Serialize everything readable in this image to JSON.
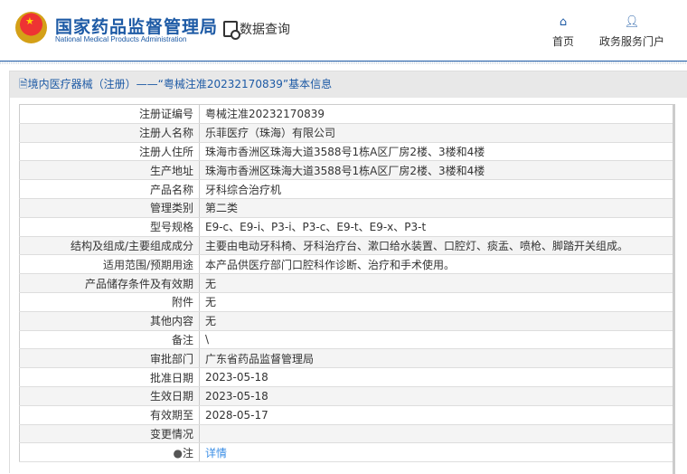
{
  "header": {
    "org_cn": "国家药品监督管理局",
    "org_en": "National Medical Products Administration",
    "data_query": "数据查询",
    "nav": [
      {
        "label": "首页",
        "icon": "home-icon"
      },
      {
        "label": "政务服务门户",
        "icon": "user-icon"
      }
    ]
  },
  "breadcrumb": "境内医疗器械（注册）——“粤械注准20232170839”基本信息",
  "rows": [
    {
      "label": "注册证编号",
      "value": "粤械注准20232170839"
    },
    {
      "label": "注册人名称",
      "value": "乐菲医疗（珠海）有限公司"
    },
    {
      "label": "注册人住所",
      "value": "珠海市香洲区珠海大道3588号1栋A区厂房2楼、3楼和4楼"
    },
    {
      "label": "生产地址",
      "value": "珠海市香洲区珠海大道3588号1栋A区厂房2楼、3楼和4楼"
    },
    {
      "label": "产品名称",
      "value": "牙科综合治疗机"
    },
    {
      "label": "管理类别",
      "value": "第二类"
    },
    {
      "label": "型号规格",
      "value": "E9-c、E9-i、P3-i、P3-c、E9-t、E9-x、P3-t"
    },
    {
      "label": "结构及组成/主要组成成分",
      "value": "主要由电动牙科椅、牙科治疗台、漱口给水装置、口腔灯、痰盂、喷枪、脚踏开关组成。"
    },
    {
      "label": "适用范围/预期用途",
      "value": "本产品供医疗部门口腔科作诊断、治疗和手术使用。"
    },
    {
      "label": "产品储存条件及有效期",
      "value": "无"
    },
    {
      "label": "附件",
      "value": "无"
    },
    {
      "label": "其他内容",
      "value": "无"
    },
    {
      "label": "备注",
      "value": "\\"
    },
    {
      "label": "审批部门",
      "value": "广东省药品监督管理局"
    },
    {
      "label": "批准日期",
      "value": "2023-05-18"
    },
    {
      "label": "生效日期",
      "value": "2023-05-18"
    },
    {
      "label": "有效期至",
      "value": "2028-05-17"
    },
    {
      "label": "变更情况",
      "value": ""
    },
    {
      "label": "注",
      "value": "详情"
    }
  ]
}
